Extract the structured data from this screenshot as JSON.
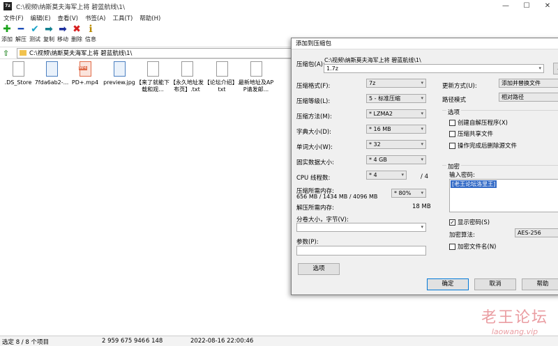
{
  "window": {
    "app_icon": "7z",
    "title": "C:\\视频\\纳斯莫夫海军上将 碧蓝航线\\1\\",
    "controls": [
      "—",
      "☐",
      "✕"
    ]
  },
  "menu": [
    "文件(F)",
    "编辑(E)",
    "查看(V)",
    "书签(A)",
    "工具(T)",
    "帮助(H)"
  ],
  "toolbar": [
    {
      "label": "添加",
      "icon": "add-icon",
      "glyph": "✚",
      "color": "#1aa21a"
    },
    {
      "label": "解压",
      "icon": "extract-icon",
      "glyph": "━",
      "color": "#1c4db8"
    },
    {
      "label": "测试",
      "icon": "test-icon",
      "glyph": "✔",
      "color": "#19a3c9"
    },
    {
      "label": "复制",
      "icon": "copy-icon",
      "glyph": "➡",
      "color": "#12808f"
    },
    {
      "label": "移动",
      "icon": "move-icon",
      "glyph": "➡",
      "color": "#1c2f9e"
    },
    {
      "label": "删除",
      "icon": "delete-icon",
      "glyph": "✖",
      "color": "#d61e1e"
    },
    {
      "label": "信息",
      "icon": "info-icon",
      "glyph": "ℹ",
      "color": "#b88a00"
    }
  ],
  "address": "C:\\视频\\纳斯莫夫海军上将 碧蓝航线\\1\\",
  "files": [
    {
      "name": ".DS_Store",
      "type": "doc"
    },
    {
      "name": "7fda6ab2-...",
      "type": "img"
    },
    {
      "name": "PD+.mp4",
      "type": "mp4",
      "badge": "MP4"
    },
    {
      "name": "preview.jpg",
      "type": "img"
    },
    {
      "name": "【来了就能下载和观...",
      "type": "doc"
    },
    {
      "name": "【永久地址发布页】.txt",
      "type": "doc"
    },
    {
      "name": "【论坛介绍】.txt",
      "type": "doc"
    },
    {
      "name": "最新地址及APP请发邮...",
      "type": "doc"
    }
  ],
  "status": {
    "selection": "选定 8 / 8 个项目",
    "size": "2 959 675 946",
    "packed": "6 148",
    "modified": "2022-08-16 22:00:46"
  },
  "dialog": {
    "title": "添加到压缩包",
    "archive_label": "压缩包(A):",
    "archive_path": "C:\\视频\\纳斯莫夫海军上将 碧蓝航线\\1\\",
    "archive_name": "1.7z",
    "format_label": "压缩格式(F):",
    "format_value": "7z",
    "level_label": "压缩等级(L):",
    "level_value": "5 - 标准压缩",
    "method_label": "压缩方法(M):",
    "method_value": "* LZMA2",
    "dict_label": "字典大小(D):",
    "dict_value": "* 16 MB",
    "word_label": "单词大小(W):",
    "word_value": "* 32",
    "solid_label": "固实数据大小:",
    "solid_value": "* 4 GB",
    "threads_label": "CPU 线程数:",
    "threads_value": "* 4",
    "threads_max": "/ 4",
    "mem_label": "压缩所需内存:",
    "mem_detail": "656 MB / 1434 MB / 4096 MB",
    "mem_percent": "* 80%",
    "decomp_label": "解压所需内存:",
    "decomp_value": "18 MB",
    "split_label": "分卷大小，字节(V):",
    "params_label": "参数(P):",
    "options_button": "选项",
    "update_label": "更新方式(U):",
    "update_value": "添加并替换文件",
    "pathmode_label": "路径模式",
    "pathmode_value": "相对路径",
    "options_group": "选项",
    "opt_sfx": "创建自解压程序(X)",
    "opt_shared": "压缩共享文件",
    "opt_delete": "操作完成后删除源文件",
    "encrypt_group": "加密",
    "pwd_label": "输入密码:",
    "pwd_value": "[老王论坛洛里王]",
    "show_pwd": "显示密码(S)",
    "enc_method_label": "加密算法:",
    "enc_method_value": "AES-256",
    "enc_names": "加密文件名(N)",
    "ok": "确定",
    "cancel": "取消",
    "help": "帮助"
  },
  "watermark": {
    "main": "老王论坛",
    "sub": "laowang.vip"
  }
}
